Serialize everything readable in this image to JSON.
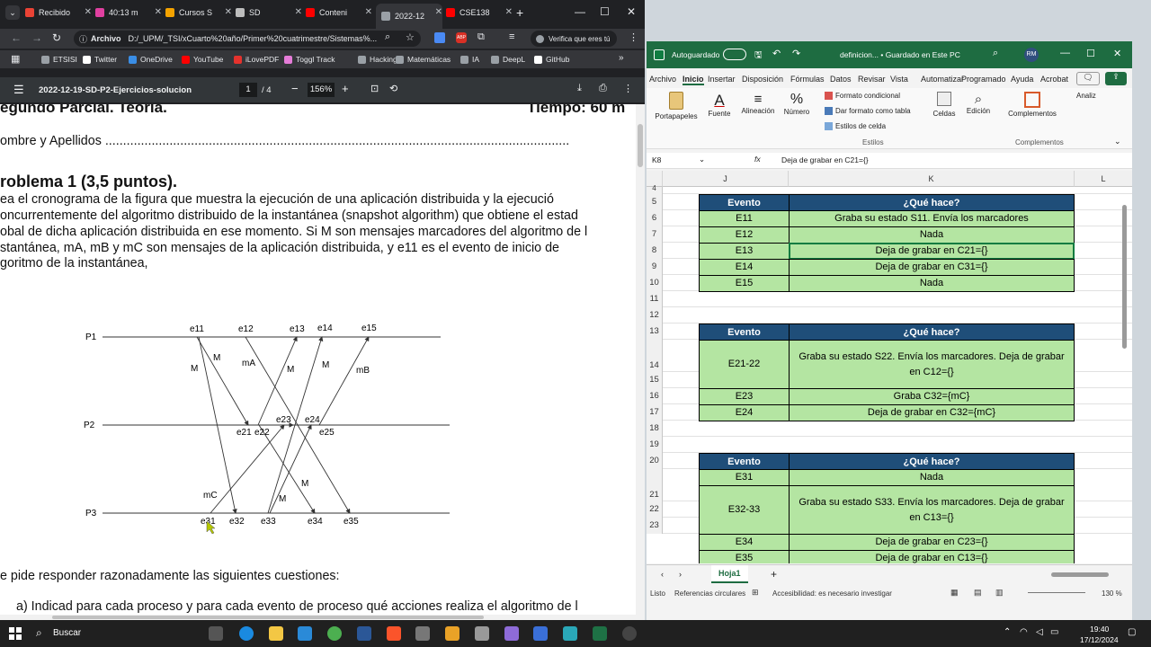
{
  "browser": {
    "tabs": [
      {
        "label": "Recibido",
        "icon": "gmail-icon",
        "color": "#ea4335"
      },
      {
        "label": "40:13 m",
        "icon": "podcast-icon",
        "color": "#e040a0"
      },
      {
        "label": "Cursos S",
        "icon": "course-icon",
        "color": "#f4a300"
      },
      {
        "label": "SD",
        "icon": "chatgpt-icon",
        "color": "#bdbdbd"
      },
      {
        "label": "Conteni",
        "icon": "youtube-icon",
        "color": "#ff0000"
      },
      {
        "label": "2022-12",
        "icon": "pdf-icon",
        "color": "#9aa0a6"
      },
      {
        "label": "CSE138",
        "icon": "youtube-icon",
        "color": "#ff0000"
      }
    ],
    "address": {
      "site_label": "Archivo",
      "url": "D:/_UPM/_TSI/xCuarto%20año/Primer%20cuatrimestre/Sistemas%...",
      "profile": "Verifica que eres tú"
    },
    "bookmarks": [
      {
        "label": "ETSISI",
        "icon": "folder-icon"
      },
      {
        "label": "Twitter",
        "icon": "x-icon"
      },
      {
        "label": "OneDrive",
        "icon": "onedrive-icon"
      },
      {
        "label": "YouTube",
        "icon": "youtube-icon"
      },
      {
        "label": "iLovePDF",
        "icon": "ilovepdf-icon"
      },
      {
        "label": "Toggl Track",
        "icon": "toggl-icon"
      },
      {
        "label": "Hacking",
        "icon": "folder-icon"
      },
      {
        "label": "Matemáticas",
        "icon": "folder-icon"
      },
      {
        "label": "IA",
        "icon": "folder-icon"
      },
      {
        "label": "DeepL",
        "icon": "folder-icon"
      },
      {
        "label": "GitHub",
        "icon": "github-icon"
      }
    ]
  },
  "pdf": {
    "title": "2022-12-19-SD-P2-Ejercicios-solucion",
    "page": "1",
    "page_total": "/ 4",
    "zoom": "156%",
    "header_left": "egundo Parcial. Teoría.",
    "header_right": "Tiempo:  60 m",
    "name_line": "ombre y Apellidos ..................................................................................................................................",
    "problem_title": "roblema 1 (3,5 puntos).",
    "para": [
      "ea el cronograma de la figura que muestra la ejecución de una aplicación distribuida y la ejecució",
      "oncurrentemente del algoritmo distribuido de la instantánea (snapshot algorithm) que obtiene el estad",
      "obal de dicha aplicación distribuida en ese momento. Si M son mensajes marcadores del algoritmo de l",
      "stantánea, mA, mB y mC son mensajes de la aplicación distribuida, y e11 es el evento de inicio de",
      "goritmo de la instantánea,"
    ],
    "question_line": "e pide responder razonadamente las siguientes cuestiones:",
    "cut_line": "a) Indicad para cada proceso y para cada evento de proceso qué acciones realiza el algoritmo de l",
    "diagram": {
      "processes": [
        "P1",
        "P2",
        "P3"
      ],
      "p1_events": [
        "e11",
        "e12",
        "e13",
        "e14",
        "e15"
      ],
      "p2_events": [
        "e21",
        "e22",
        "e23",
        "e24",
        "e25"
      ],
      "p3_events": [
        "e31",
        "e32",
        "e33",
        "e34",
        "e35"
      ],
      "messages": [
        "M",
        "M",
        "mA",
        "M",
        "M",
        "mB",
        "mC",
        "M",
        "M"
      ]
    }
  },
  "excel": {
    "autosave": "Autoguardado",
    "filename": "definicion... • Guardado en Este PC",
    "user_initials": "RM",
    "menu": [
      "Archivo",
      "Inicio",
      "Insertar",
      "Disposición",
      "Fórmulas",
      "Datos",
      "Revisar",
      "Vista",
      "Automatizar",
      "Programado",
      "Ayuda",
      "Acrobat"
    ],
    "ribbon": {
      "portapapeles": "Portapapeles",
      "fuente": "Fuente",
      "alineacion": "Alineación",
      "numero": "Número",
      "cond_format": "Formato condicional",
      "table_format": "Dar formato como tabla",
      "cell_styles": "Estilos de celda",
      "estilos": "Estilos",
      "celdas": "Celdas",
      "edicion": "Edición",
      "complementos": "Complementos",
      "complementos_group": "Complementos",
      "analizar": "Analiz"
    },
    "namebox": "K8",
    "formula": "Deja de grabar en C21={}",
    "columns": [
      "J",
      "K",
      "L"
    ],
    "rows": [
      {
        "n": "4"
      },
      {
        "n": "5"
      },
      {
        "n": "6"
      },
      {
        "n": "7"
      },
      {
        "n": "8"
      },
      {
        "n": "9"
      },
      {
        "n": "10"
      },
      {
        "n": "11"
      },
      {
        "n": "12"
      },
      {
        "n": "13"
      },
      {
        "n": "14"
      },
      {
        "n": "15"
      },
      {
        "n": "16"
      },
      {
        "n": "17"
      },
      {
        "n": "18"
      },
      {
        "n": "19"
      },
      {
        "n": "20"
      },
      {
        "n": "21"
      },
      {
        "n": "22"
      },
      {
        "n": "23"
      }
    ],
    "table1": {
      "h1": "Evento",
      "h2": "¿Qué hace?",
      "rows": [
        {
          "e": "E11",
          "d": "Graba su estado S11. Envía los marcadores"
        },
        {
          "e": "E12",
          "d": "Nada"
        },
        {
          "e": "E13",
          "d": "Deja de grabar en C21={}"
        },
        {
          "e": "E14",
          "d": "Deja de grabar en C31={}"
        },
        {
          "e": "E15",
          "d": "Nada"
        }
      ]
    },
    "table2": {
      "h1": "Evento",
      "h2": "¿Qué hace?",
      "rows": [
        {
          "e": "E21-22",
          "d": "Graba su estado S22. Envía los marcadores. Deja de grabar en C12={}"
        },
        {
          "e": "E23",
          "d": "Graba C32={mC}"
        },
        {
          "e": "E24",
          "d": "Deja de grabar en C32={mC}"
        }
      ]
    },
    "table3": {
      "h1": "Evento",
      "h2": "¿Qué hace?",
      "rows": [
        {
          "e": "E31",
          "d": "Nada"
        },
        {
          "e": "E32-33",
          "d": "Graba su estado S33. Envía los marcadores. Deja de grabar en C13={}"
        },
        {
          "e": "E34",
          "d": "Deja de grabar en C23={}"
        },
        {
          "e": "E35",
          "d": "Deja de grabar en C13={}"
        }
      ]
    },
    "sheet_tab": "Hoja1",
    "status_ready": "Listo",
    "status_circular": "Referencias circulares",
    "status_access": "Accesibilidad: es necesario investigar",
    "zoom": "130 %"
  },
  "taskbar": {
    "search": "Buscar",
    "time": "19:40",
    "date": "17/12/2024"
  }
}
